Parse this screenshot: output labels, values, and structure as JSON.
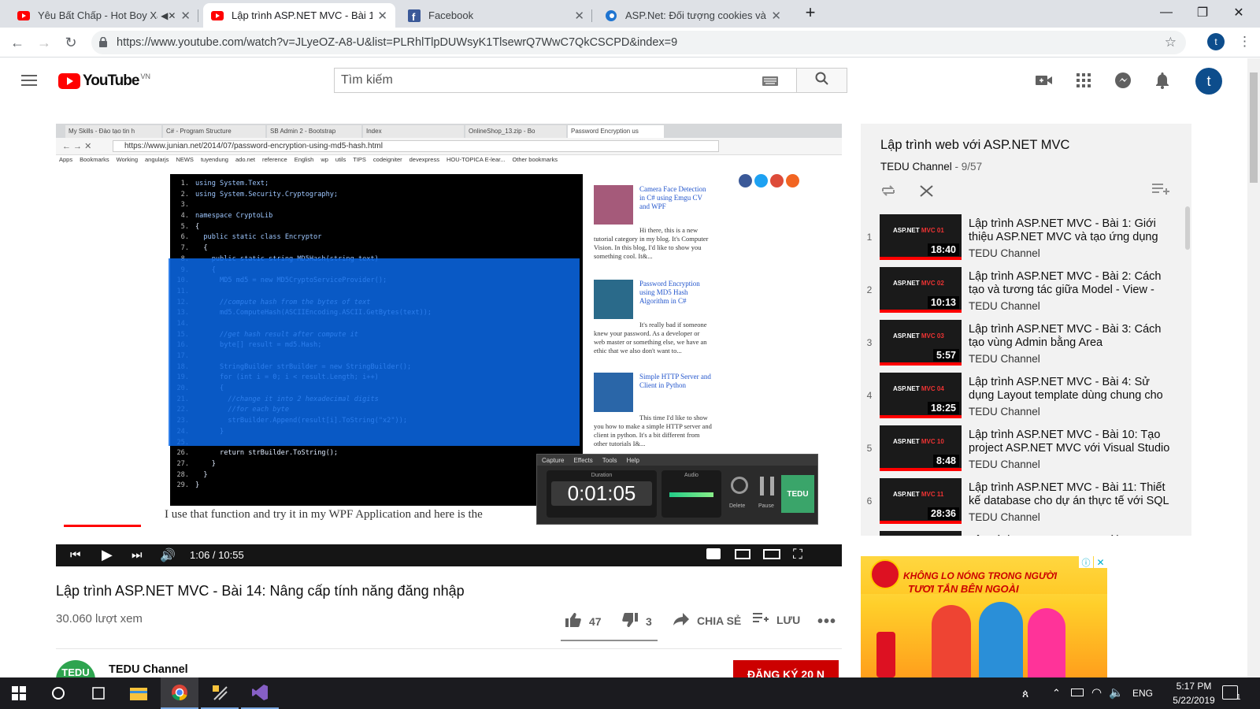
{
  "browser": {
    "tabs": [
      {
        "title": "Yêu Bất Chấp - Hot Boy Xăm",
        "favicon": "youtube-icon",
        "muted": true
      },
      {
        "title": "Lập trình ASP.NET MVC - Bài 14: N",
        "favicon": "youtube-icon",
        "active": true
      },
      {
        "title": "Facebook",
        "favicon": "facebook-icon"
      },
      {
        "title": "ASP.Net: Đối tượng cookies và s",
        "favicon": "edge-icon"
      }
    ],
    "url": "https://www.youtube.com/watch?v=JLyeOZ-A8-U&list=PLRhlTlpDUWsyK1TlsewrQ7WwC7QkCSCPD&index=9",
    "profile_initial": "t"
  },
  "youtube": {
    "logo_text": "YouTube",
    "region": "VN",
    "search_placeholder": "Tìm kiếm",
    "avatar_initial": "t"
  },
  "player": {
    "time_display": "1:06 / 10:55",
    "progress_fraction": 0.1,
    "capture_timer": "0:01:05",
    "capture_menu": [
      "Capture",
      "Effects",
      "Tools",
      "Help"
    ],
    "capture_labels": {
      "duration": "Duration",
      "audio": "Audio",
      "delete": "Delete",
      "pause": "Pause"
    },
    "subtitle_text": "I use that function and try it in my WPF Application and here is the",
    "inner_browser": {
      "tabs": [
        "My Skills - Đào tạo tin h",
        "C# - Program Structure",
        "SB Admin 2 - Bootstrap",
        "Index",
        "OnlineShop_13.zip - Bo",
        "Password Encryption us"
      ],
      "url": "https://www.junian.net/2014/07/password-encryption-using-md5-hash.html",
      "bookmarks": [
        "Apps",
        "Bookmarks",
        "Working",
        "angularjs",
        "NEWS",
        "tuyendung",
        "ado.net",
        "reference",
        "English",
        "wp",
        "utils",
        "TIPS",
        "codeigniter",
        "devexpress",
        "HOU-TOPICA E-lear...",
        "Other bookmarks"
      ],
      "sidebar_posts": [
        {
          "title": "Camera Face Detection in C# using Emgu CV and WPF",
          "excerpt": "Hi there, this is a new tutorial category in my blog. It's Computer Vision. In this blog, I'd like to show you something cool. It&..."
        },
        {
          "title": "Password Encryption using MD5 Hash Algorithm in C#",
          "excerpt": "It's really bad if someone knew your password. As a developer or web master or something else, we have an ethic that we also don't want to..."
        },
        {
          "title": "Simple HTTP Server and Client in Python",
          "excerpt": "This time I'd like to show you how to make a simple HTTP server and client in python. It's a bit different from other tutorials I&..."
        }
      ],
      "code_lines": [
        "using System.Text;",
        "using System.Security.Cryptography;",
        "",
        "namespace CryptoLib",
        "{",
        "  public static class Encryptor",
        "  {",
        "    public static string MD5Hash(string text)",
        "    {",
        "      MD5 md5 = new MD5CryptoServiceProvider();",
        "",
        "      //compute hash from the bytes of text",
        "      md5.ComputeHash(ASCIIEncoding.ASCII.GetBytes(text));",
        "",
        "      //get hash result after compute it",
        "      byte[] result = md5.Hash;",
        "",
        "      StringBuilder strBuilder = new StringBuilder();",
        "      for (int i = 0; i < result.Length; i++)",
        "      {",
        "        //change it into 2 hexadecimal digits",
        "        //for each byte",
        "        strBuilder.Append(result[i].ToString(\"x2\"));",
        "      }",
        "",
        "      return strBuilder.ToString();",
        "    }",
        "  }",
        "}"
      ]
    }
  },
  "video": {
    "title": "Lập trình ASP.NET MVC - Bài 14: Nâng cấp tính năng đăng nhập",
    "views": "30.060 lượt xem",
    "likes": "47",
    "dislikes": "3",
    "share_label": "CHIA SẺ",
    "save_label": "LƯU",
    "channel": "TEDU Channel",
    "subscribe_label": "ĐĂNG KÝ 20 N"
  },
  "playlist": {
    "title": "Lập trình web với ASP.NET MVC",
    "channel": "TEDU Channel",
    "position": "9/57",
    "items": [
      {
        "index": "1",
        "title": "Lập trình ASP.NET MVC - Bài 1: Giới thiệu ASP.NET MVC và tạo ứng dụng",
        "channel": "TEDU Channel",
        "duration": "18:40",
        "badge": "01"
      },
      {
        "index": "2",
        "title": "Lập trình ASP.NET MVC - Bài 2: Cách tạo và tương tác giữa Model - View -",
        "channel": "TEDU Channel",
        "duration": "10:13",
        "badge": "02"
      },
      {
        "index": "3",
        "title": "Lập trình ASP.NET MVC - Bài 3: Cách tạo vùng Admin bằng Area",
        "channel": "TEDU Channel",
        "duration": "5:57",
        "badge": "03"
      },
      {
        "index": "4",
        "title": "Lập trình ASP.NET MVC - Bài 4: Sử dụng Layout template dùng chung cho",
        "channel": "TEDU Channel",
        "duration": "18:25",
        "badge": "04"
      },
      {
        "index": "5",
        "title": "Lập trình ASP.NET MVC - Bài 10: Tạo project ASP.NET MVC với Visual Studio",
        "channel": "TEDU Channel",
        "duration": "8:48",
        "badge": "10"
      },
      {
        "index": "6",
        "title": "Lập trình ASP.NET MVC - Bài 11: Thiết kế database cho dự án thực tế với SQL",
        "channel": "TEDU Channel",
        "duration": "28:36",
        "badge": "11"
      },
      {
        "index": "",
        "title": "Lập trình ASP.NET MVC - Bài 12: Tạo",
        "channel": "",
        "duration": "",
        "badge": ""
      }
    ]
  },
  "ad": {
    "headline1": "KHÔNG LO NÓNG TRONG NGƯỜI",
    "headline2": "TƯƠI TẮN BÊN NGOÀI"
  },
  "taskbar": {
    "language": "ENG",
    "time": "5:17 PM",
    "date": "5/22/2019",
    "notification_count": "1"
  }
}
